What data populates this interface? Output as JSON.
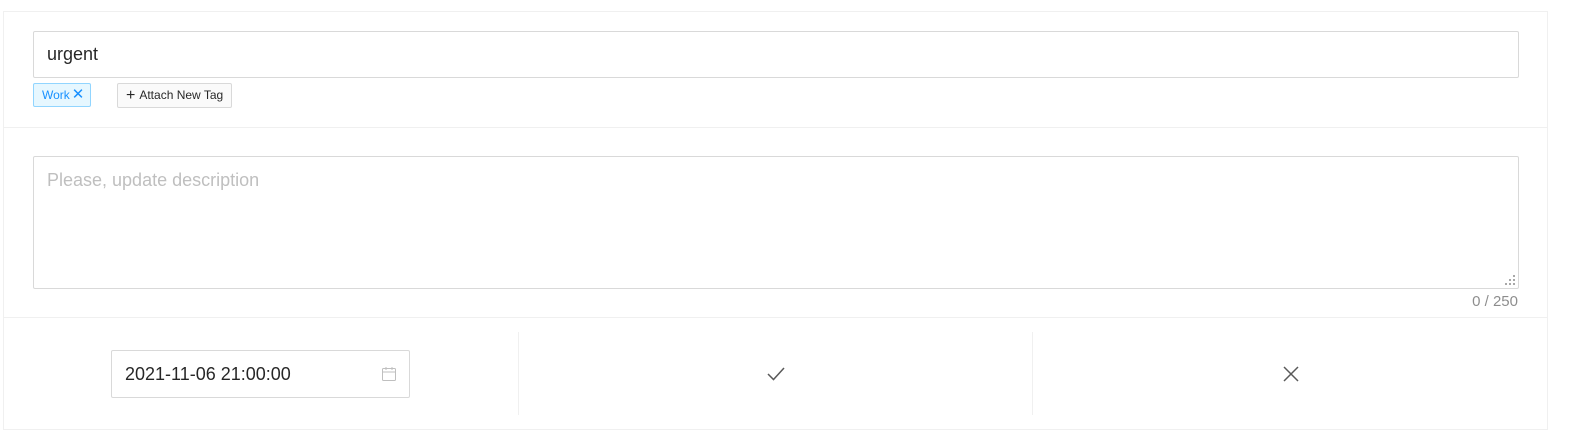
{
  "title_field": {
    "value": "urgent"
  },
  "tags": [
    {
      "label": "Work",
      "close_icon": "close-icon",
      "color": "#1890ff"
    }
  ],
  "new_tag": {
    "label": "Attach New Tag",
    "icon": "plus-icon"
  },
  "description": {
    "value": "",
    "placeholder": "Please, update description",
    "counter": "0 / 250"
  },
  "actions": {
    "date_value": "2021-11-06 21:00:00",
    "date_icon": "calendar-icon",
    "confirm_icon": "check-icon",
    "cancel_icon": "close-icon"
  }
}
